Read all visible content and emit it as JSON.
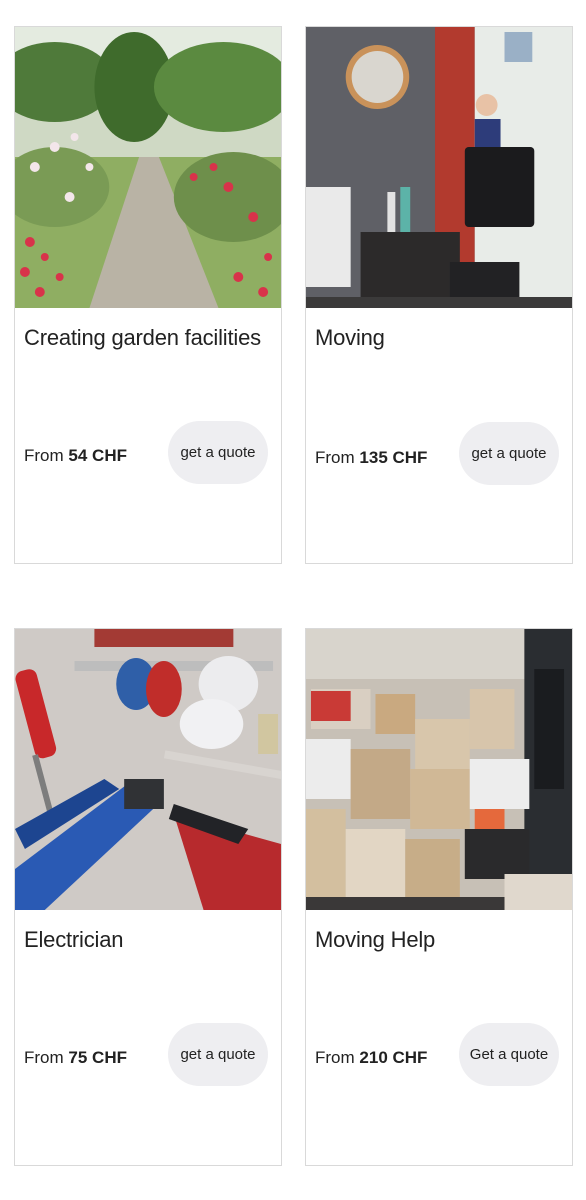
{
  "services": [
    {
      "title": "Creating garden facilities",
      "price_prefix": "From",
      "price_value": "54 CHF",
      "button_label": "get a quote",
      "image_subject": "rose-garden-path"
    },
    {
      "title": "Moving",
      "price_prefix": "From",
      "price_value": "135 CHF",
      "button_label": "get a quote",
      "image_subject": "man-carrying-moving-crate"
    },
    {
      "title": "Electrician",
      "price_prefix": "From",
      "price_value": "75 CHF",
      "button_label": "get a quote",
      "image_subject": "electrician-tools-and-bulbs"
    },
    {
      "title": "Moving Help",
      "price_prefix": "From",
      "price_value": "210 CHF",
      "button_label": "Get a quote",
      "image_subject": "stacked-cardboard-boxes"
    }
  ],
  "colors": {
    "card_border": "#d9d9d9",
    "button_bg": "#eeeef1",
    "text": "#222222"
  }
}
